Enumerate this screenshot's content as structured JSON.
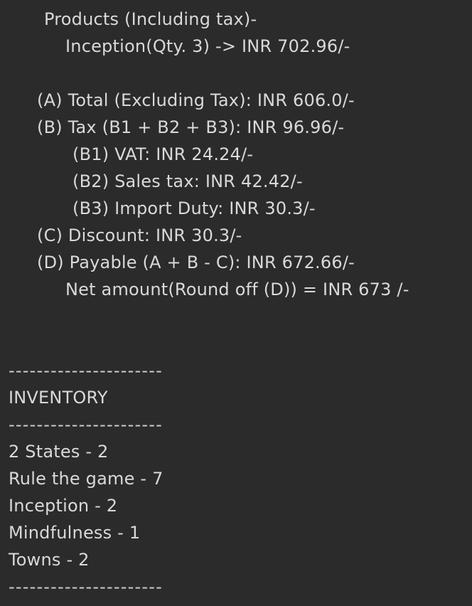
{
  "receipt": {
    "products_header": "Products (Including tax)-",
    "product_line": "Inception(Qty. 3) -> INR 702.96/-",
    "total_excluding_tax": "(A) Total (Excluding Tax): INR 606.0/-",
    "tax": "(B) Tax (B1 + B2 + B3): INR 96.96/-",
    "vat": "(B1) VAT: INR 24.24/-",
    "sales_tax": "(B2) Sales tax: INR 42.42/-",
    "import_duty": "(B3) Import Duty: INR 30.3/-",
    "discount": "(C) Discount: INR 30.3/-",
    "payable": "(D) Payable (A + B - C): INR 672.66/-",
    "net_amount": "Net amount(Round off (D)) = INR 673 /-"
  },
  "inventory": {
    "divider": "----------------------",
    "title": "INVENTORY",
    "items": [
      "2 States - 2",
      "Rule the game - 7",
      "Inception - 2",
      "Mindfulness - 1",
      "Towns - 2"
    ]
  }
}
